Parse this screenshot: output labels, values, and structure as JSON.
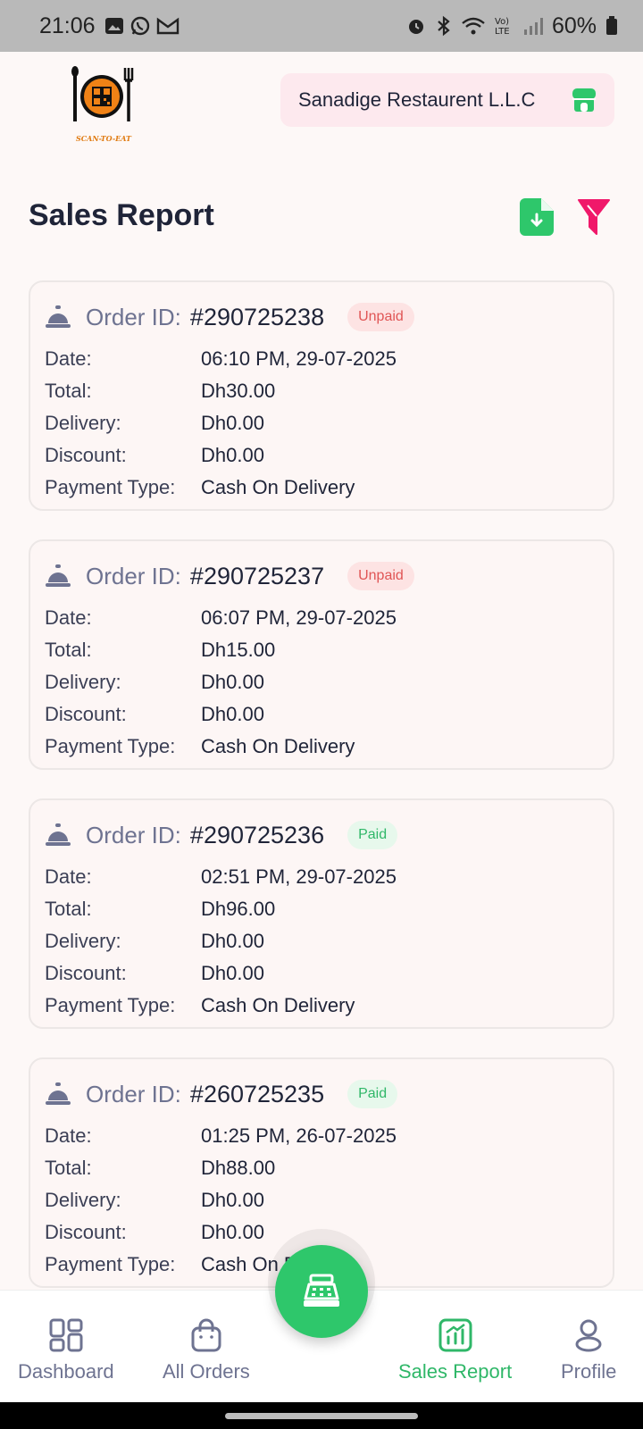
{
  "status_bar": {
    "time": "21:06",
    "battery": "60%",
    "left_icons": [
      "image-icon",
      "whatsapp-icon",
      "gmail-icon"
    ],
    "right_icons": [
      "alarm-icon",
      "bluetooth-icon",
      "wifi-icon",
      "volte-icon",
      "signal-icon",
      "battery-icon"
    ]
  },
  "header": {
    "logo_text": "SCAN-TO-EAT",
    "restaurant_name": "Sanadige Restaurent L.L.C"
  },
  "page": {
    "title": "Sales Report"
  },
  "labels": {
    "order_id": "Order ID:",
    "date": "Date:",
    "total": "Total:",
    "delivery": "Delivery:",
    "discount": "Discount:",
    "payment_type": "Payment Type:"
  },
  "orders": [
    {
      "id": "#290725238",
      "status": "Unpaid",
      "date": "06:10 PM, 29-07-2025",
      "total": "Dh30.00",
      "delivery": "Dh0.00",
      "discount": "Dh0.00",
      "payment": "Cash On Delivery"
    },
    {
      "id": "#290725237",
      "status": "Unpaid",
      "date": "06:07 PM, 29-07-2025",
      "total": "Dh15.00",
      "delivery": "Dh0.00",
      "discount": "Dh0.00",
      "payment": "Cash On Delivery"
    },
    {
      "id": "#290725236",
      "status": "Paid",
      "date": "02:51 PM, 29-07-2025",
      "total": "Dh96.00",
      "delivery": "Dh0.00",
      "discount": "Dh0.00",
      "payment": "Cash On Delivery"
    },
    {
      "id": "#260725235",
      "status": "Paid",
      "date": "01:25 PM, 26-07-2025",
      "total": "Dh88.00",
      "delivery": "Dh0.00",
      "discount": "Dh0.00",
      "payment": "Cash On Delivery"
    }
  ],
  "bottom_nav": {
    "items": [
      {
        "label": "Dashboard",
        "icon": "grid-icon",
        "active": false
      },
      {
        "label": "All Orders",
        "icon": "bag-icon",
        "active": false
      },
      {
        "label": "Sales Report",
        "icon": "chart-icon",
        "active": true
      },
      {
        "label": "Profile",
        "icon": "person-icon",
        "active": false
      }
    ],
    "fab_icon": "cash-register-icon"
  },
  "colors": {
    "accent_green": "#2ec76b",
    "unpaid_red": "#e05555",
    "filter_pink": "#f0186a",
    "pill_pink": "#fde9ee"
  }
}
